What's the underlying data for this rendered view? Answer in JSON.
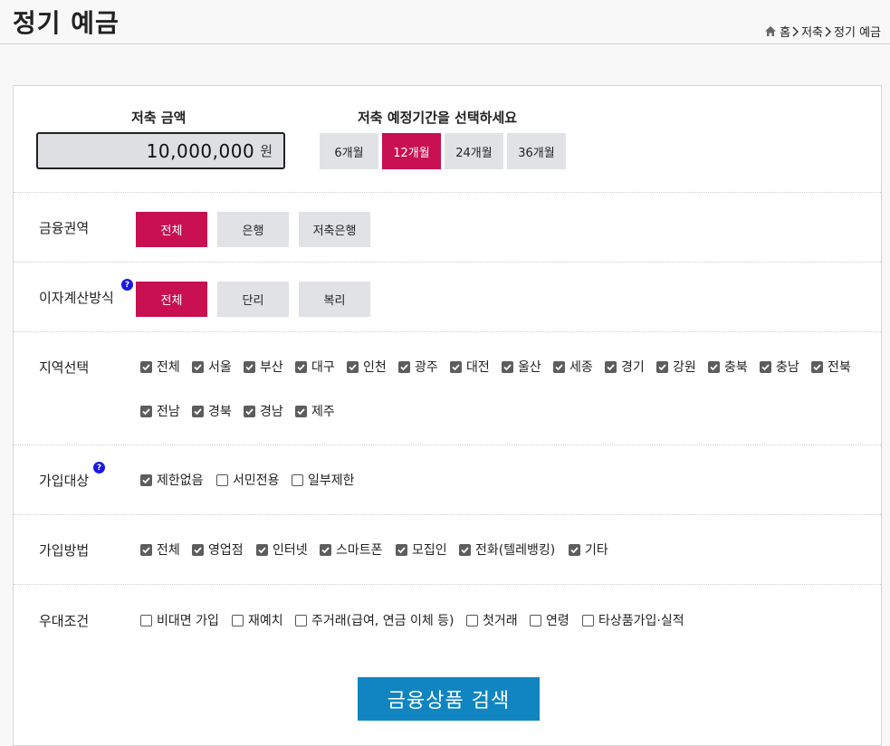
{
  "header": {
    "title": "정기 예금",
    "breadcrumb": [
      "홈",
      "저축",
      "정기 예금"
    ]
  },
  "amount": {
    "label": "저축 금액",
    "value": "10,000,000",
    "unit": "원"
  },
  "period": {
    "label": "저축 예정기간을 선택하세요",
    "options": [
      "6개월",
      "12개월",
      "24개월",
      "36개월"
    ],
    "selected": "12개월"
  },
  "sector": {
    "label": "금융권역",
    "options": [
      "전체",
      "은행",
      "저축은행"
    ],
    "selected": "전체"
  },
  "interest": {
    "label": "이자계산방식",
    "help": "?",
    "options": [
      "전체",
      "단리",
      "복리"
    ],
    "selected": "전체"
  },
  "region": {
    "label": "지역선택",
    "row1": [
      {
        "label": "전체",
        "checked": true
      },
      {
        "label": "서울",
        "checked": true
      },
      {
        "label": "부산",
        "checked": true
      },
      {
        "label": "대구",
        "checked": true
      },
      {
        "label": "인천",
        "checked": true
      },
      {
        "label": "광주",
        "checked": true
      },
      {
        "label": "대전",
        "checked": true
      },
      {
        "label": "울산",
        "checked": true
      },
      {
        "label": "세종",
        "checked": true
      },
      {
        "label": "경기",
        "checked": true
      },
      {
        "label": "강원",
        "checked": true
      },
      {
        "label": "충북",
        "checked": true
      },
      {
        "label": "충남",
        "checked": true
      },
      {
        "label": "전북",
        "checked": true
      }
    ],
    "row2": [
      {
        "label": "전남",
        "checked": true
      },
      {
        "label": "경북",
        "checked": true
      },
      {
        "label": "경남",
        "checked": true
      },
      {
        "label": "제주",
        "checked": true
      }
    ]
  },
  "eligibility": {
    "label": "가입대상",
    "help": "?",
    "options": [
      {
        "label": "제한없음",
        "checked": true
      },
      {
        "label": "서민전용",
        "checked": false
      },
      {
        "label": "일부제한",
        "checked": false
      }
    ]
  },
  "method": {
    "label": "가입방법",
    "options": [
      {
        "label": "전체",
        "checked": true
      },
      {
        "label": "영업점",
        "checked": true
      },
      {
        "label": "인터넷",
        "checked": true
      },
      {
        "label": "스마트폰",
        "checked": true
      },
      {
        "label": "모집인",
        "checked": true
      },
      {
        "label": "전화(텔레뱅킹)",
        "checked": true
      },
      {
        "label": "기타",
        "checked": true
      }
    ]
  },
  "benefits": {
    "label": "우대조건",
    "options": [
      {
        "label": "비대면 가입",
        "checked": false
      },
      {
        "label": "재예치",
        "checked": false
      },
      {
        "label": "주거래(급여, 연금 이체 등)",
        "checked": false
      },
      {
        "label": "첫거래",
        "checked": false
      },
      {
        "label": "연령",
        "checked": false
      },
      {
        "label": "타상품가입·실적",
        "checked": false
      }
    ]
  },
  "search_button": "금융상품 검색",
  "colors": {
    "accent": "#c81051",
    "search": "#1085c1",
    "help": "#1a1ae0"
  }
}
